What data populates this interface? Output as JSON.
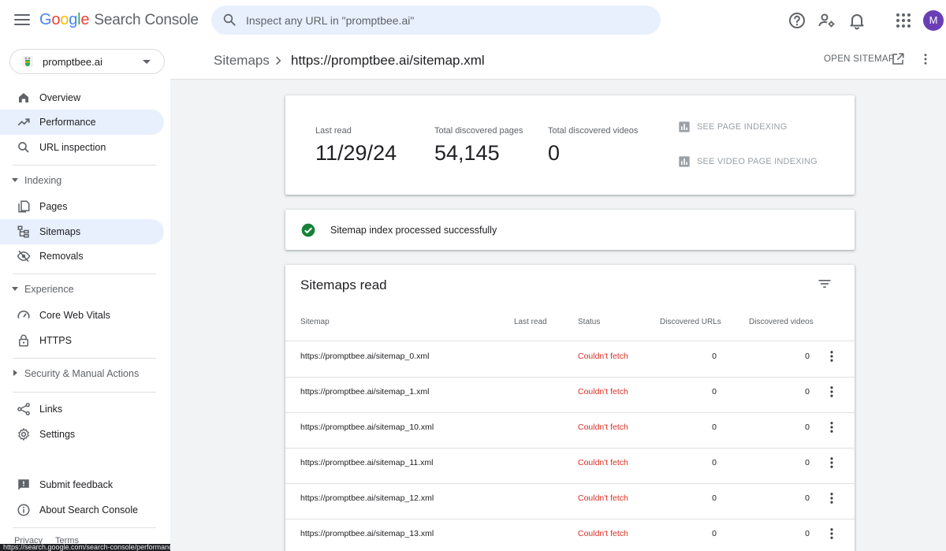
{
  "app": {
    "logo_letters": [
      "G",
      "o",
      "o",
      "g",
      "l",
      "e"
    ],
    "product": "Search Console",
    "search_placeholder": "Inspect any URL in \"promptbee.ai\"",
    "avatar_initial": "M"
  },
  "property": {
    "label": "promptbee.ai"
  },
  "sidebar": {
    "items_top": [
      {
        "label": "Overview",
        "icon": "home-icon"
      },
      {
        "label": "Performance",
        "icon": "trending-icon"
      },
      {
        "label": "URL inspection",
        "icon": "search-icon"
      }
    ],
    "indexing": {
      "label": "Indexing",
      "items": [
        {
          "label": "Pages",
          "icon": "pages-icon"
        },
        {
          "label": "Sitemaps",
          "icon": "sitemap-icon"
        },
        {
          "label": "Removals",
          "icon": "removals-icon"
        }
      ]
    },
    "experience": {
      "label": "Experience",
      "items": [
        {
          "label": "Core Web Vitals",
          "icon": "speed-icon"
        },
        {
          "label": "HTTPS",
          "icon": "lock-icon"
        }
      ]
    },
    "security": {
      "label": "Security & Manual Actions"
    },
    "items_bottom": [
      {
        "label": "Links",
        "icon": "links-icon"
      },
      {
        "label": "Settings",
        "icon": "gear-icon"
      }
    ],
    "footer_items": [
      {
        "label": "Submit feedback",
        "icon": "feedback-icon"
      },
      {
        "label": "About Search Console",
        "icon": "info-icon"
      }
    ],
    "privacy": "Privacy",
    "terms": "Terms",
    "status_url": "https://search.google.com/search-console/performance/search-analytics?resource_id=sc-do..."
  },
  "header": {
    "breadcrumb_root": "Sitemaps",
    "breadcrumb_current": "https://promptbee.ai/sitemap.xml",
    "open_sitemap": "OPEN SITEMAP"
  },
  "stats": {
    "last_read_label": "Last read",
    "last_read_value": "11/29/24",
    "pages_label": "Total discovered pages",
    "pages_value": "54,145",
    "videos_label": "Total discovered videos",
    "videos_value": "0",
    "see_page_indexing": "SEE PAGE INDEXING",
    "see_video_indexing": "SEE VIDEO PAGE INDEXING"
  },
  "status": {
    "message": "Sitemap index processed successfully"
  },
  "table": {
    "title": "Sitemaps read",
    "columns": [
      "Sitemap",
      "Last read",
      "Status",
      "Discovered URLs",
      "Discovered videos"
    ],
    "rows": [
      {
        "sitemap": "https://promptbee.ai/sitemap_0.xml",
        "last_read": "",
        "status": "Couldn't fetch",
        "urls": "0",
        "videos": "0"
      },
      {
        "sitemap": "https://promptbee.ai/sitemap_1.xml",
        "last_read": "",
        "status": "Couldn't fetch",
        "urls": "0",
        "videos": "0"
      },
      {
        "sitemap": "https://promptbee.ai/sitemap_10.xml",
        "last_read": "",
        "status": "Couldn't fetch",
        "urls": "0",
        "videos": "0"
      },
      {
        "sitemap": "https://promptbee.ai/sitemap_11.xml",
        "last_read": "",
        "status": "Couldn't fetch",
        "urls": "0",
        "videos": "0"
      },
      {
        "sitemap": "https://promptbee.ai/sitemap_12.xml",
        "last_read": "",
        "status": "Couldn't fetch",
        "urls": "0",
        "videos": "0"
      },
      {
        "sitemap": "https://promptbee.ai/sitemap_13.xml",
        "last_read": "",
        "status": "Couldn't fetch",
        "urls": "0",
        "videos": "0"
      }
    ]
  },
  "colors": {
    "accent": "#1a73e8",
    "active_nav": "#e8f0fe",
    "error": "#d93025",
    "success": "#188038",
    "avatar": "#6a3fb5"
  }
}
